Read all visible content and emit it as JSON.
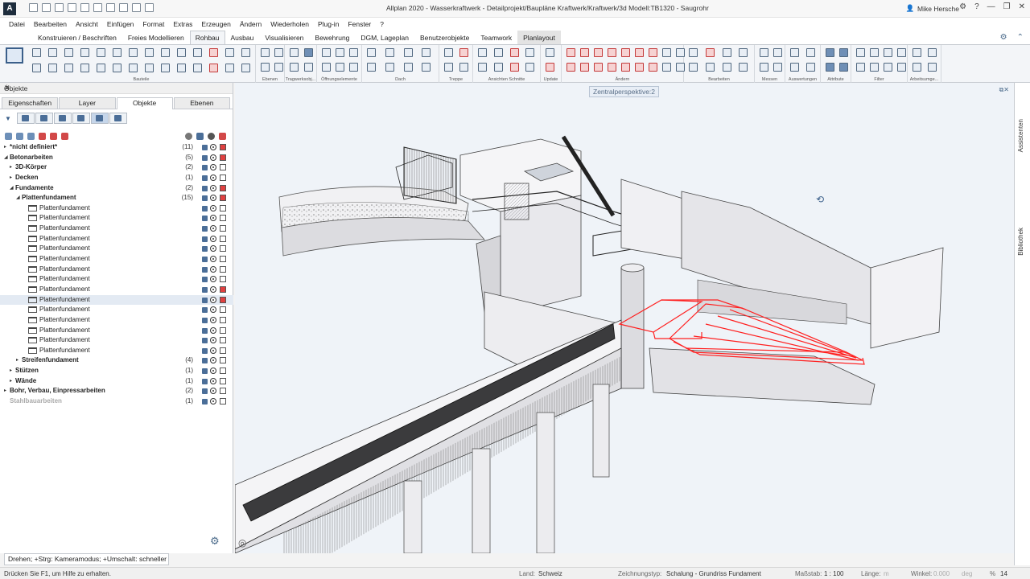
{
  "window": {
    "title": "Allplan 2020 - Wasserkraftwerk - Detailprojekt/Baupläne Kraftwerk/Kraftwerk/3d Modell:TB1320 - Saugrohr",
    "user": "Mike Hersche",
    "logo_letter": "A"
  },
  "menu": [
    "Datei",
    "Bearbeiten",
    "Ansicht",
    "Einfügen",
    "Format",
    "Extras",
    "Erzeugen",
    "Ändern",
    "Wiederholen",
    "Plug-in",
    "Fenster",
    "?"
  ],
  "ribbon_tabs": [
    "Konstruieren / Beschriften",
    "Freies Modellieren",
    "Rohbau",
    "Ausbau",
    "Visualisieren",
    "Bewehrung",
    "DGM, Lageplan",
    "Benutzerobjekte",
    "Teamwork",
    "Planlayout"
  ],
  "ribbon_active_tab": "Rohbau",
  "ribbon_groups": [
    "Bauteile",
    "Ebenen",
    "Tragwerksobj...",
    "Öffnungselemente",
    "Dach",
    "Treppe",
    "Ansichten Schnitte",
    "Update",
    "Ändern",
    "Bearbeiten",
    "Messen",
    "Auswertungen",
    "Attribute",
    "Filter",
    "Arbeitsumge..."
  ],
  "panel": {
    "title": "Objekte",
    "tabs": [
      "Eigenschaften",
      "Layer",
      "Objekte",
      "Ebenen"
    ],
    "active_tab": "Objekte",
    "tree": [
      {
        "label": "*nicht definiert*",
        "count": "(11)",
        "level": 0,
        "expander": "▸",
        "bold": true,
        "red": true
      },
      {
        "label": "Betonarbeiten",
        "count": "(5)",
        "level": 0,
        "expander": "◢",
        "bold": true,
        "red": true
      },
      {
        "label": "3D-Körper",
        "count": "(2)",
        "level": 1,
        "expander": "▸",
        "bold": true
      },
      {
        "label": "Decken",
        "count": "(1)",
        "level": 1,
        "expander": "▸",
        "bold": true
      },
      {
        "label": "Fundamente",
        "count": "(2)",
        "level": 1,
        "expander": "◢",
        "bold": true,
        "red": true
      },
      {
        "label": "Plattenfundament",
        "count": "(15)",
        "level": 2,
        "expander": "◢",
        "bold": true,
        "red": true
      },
      {
        "label": "Plattenfundament",
        "level": 3,
        "leaf": true
      },
      {
        "label": "Plattenfundament",
        "level": 3,
        "leaf": true
      },
      {
        "label": "Plattenfundament",
        "level": 3,
        "leaf": true
      },
      {
        "label": "Plattenfundament",
        "level": 3,
        "leaf": true
      },
      {
        "label": "Plattenfundament",
        "level": 3,
        "leaf": true
      },
      {
        "label": "Plattenfundament",
        "level": 3,
        "leaf": true
      },
      {
        "label": "Plattenfundament",
        "level": 3,
        "leaf": true
      },
      {
        "label": "Plattenfundament",
        "level": 3,
        "leaf": true
      },
      {
        "label": "Plattenfundament",
        "level": 3,
        "leaf": true,
        "red": true
      },
      {
        "label": "Plattenfundament",
        "level": 3,
        "leaf": true,
        "red": true,
        "selected": true
      },
      {
        "label": "Plattenfundament",
        "level": 3,
        "leaf": true
      },
      {
        "label": "Plattenfundament",
        "level": 3,
        "leaf": true
      },
      {
        "label": "Plattenfundament",
        "level": 3,
        "leaf": true
      },
      {
        "label": "Plattenfundament",
        "level": 3,
        "leaf": true
      },
      {
        "label": "Plattenfundament",
        "level": 3,
        "leaf": true
      },
      {
        "label": "Streifenfundament",
        "count": "(4)",
        "level": 2,
        "expander": "▸",
        "bold": true
      },
      {
        "label": "Stützen",
        "count": "(1)",
        "level": 1,
        "expander": "▸",
        "bold": true
      },
      {
        "label": "Wände",
        "count": "(1)",
        "level": 1,
        "expander": "▸",
        "bold": true
      },
      {
        "label": "Bohr, Verbau, Einpressarbeiten",
        "count": "(2)",
        "level": 0,
        "expander": "▸",
        "bold": true
      },
      {
        "label": "Stahlbauarbeiten",
        "count": "(1)",
        "level": 0,
        "expander": "",
        "bold": true,
        "grey": true
      }
    ]
  },
  "hint": "Drehen; +Strg: Kameramodus; +Umschalt: schneller",
  "viewport": {
    "label": "Zentralperspektive:2"
  },
  "sidebar_right": [
    "Assistenten",
    "Bibliothek"
  ],
  "status": {
    "help": "Drücken Sie F1, um Hilfe zu erhalten.",
    "land_label": "Land:",
    "land": "Schweiz",
    "type_label": "Zeichnungstyp:",
    "type": "Schalung  -  Grundriss Fundament",
    "scale_label": "Maßstab:",
    "scale": "1 : 100",
    "length_label": "Länge:",
    "length": "m",
    "angle_label": "Winkel:",
    "angle": "0.000",
    "angle_unit": "deg",
    "percent_label": "%",
    "percent": "14"
  },
  "colors": {
    "accent": "#3b5f8a",
    "selection": "#ff2020",
    "viewport_bg": "#eff3f8"
  }
}
